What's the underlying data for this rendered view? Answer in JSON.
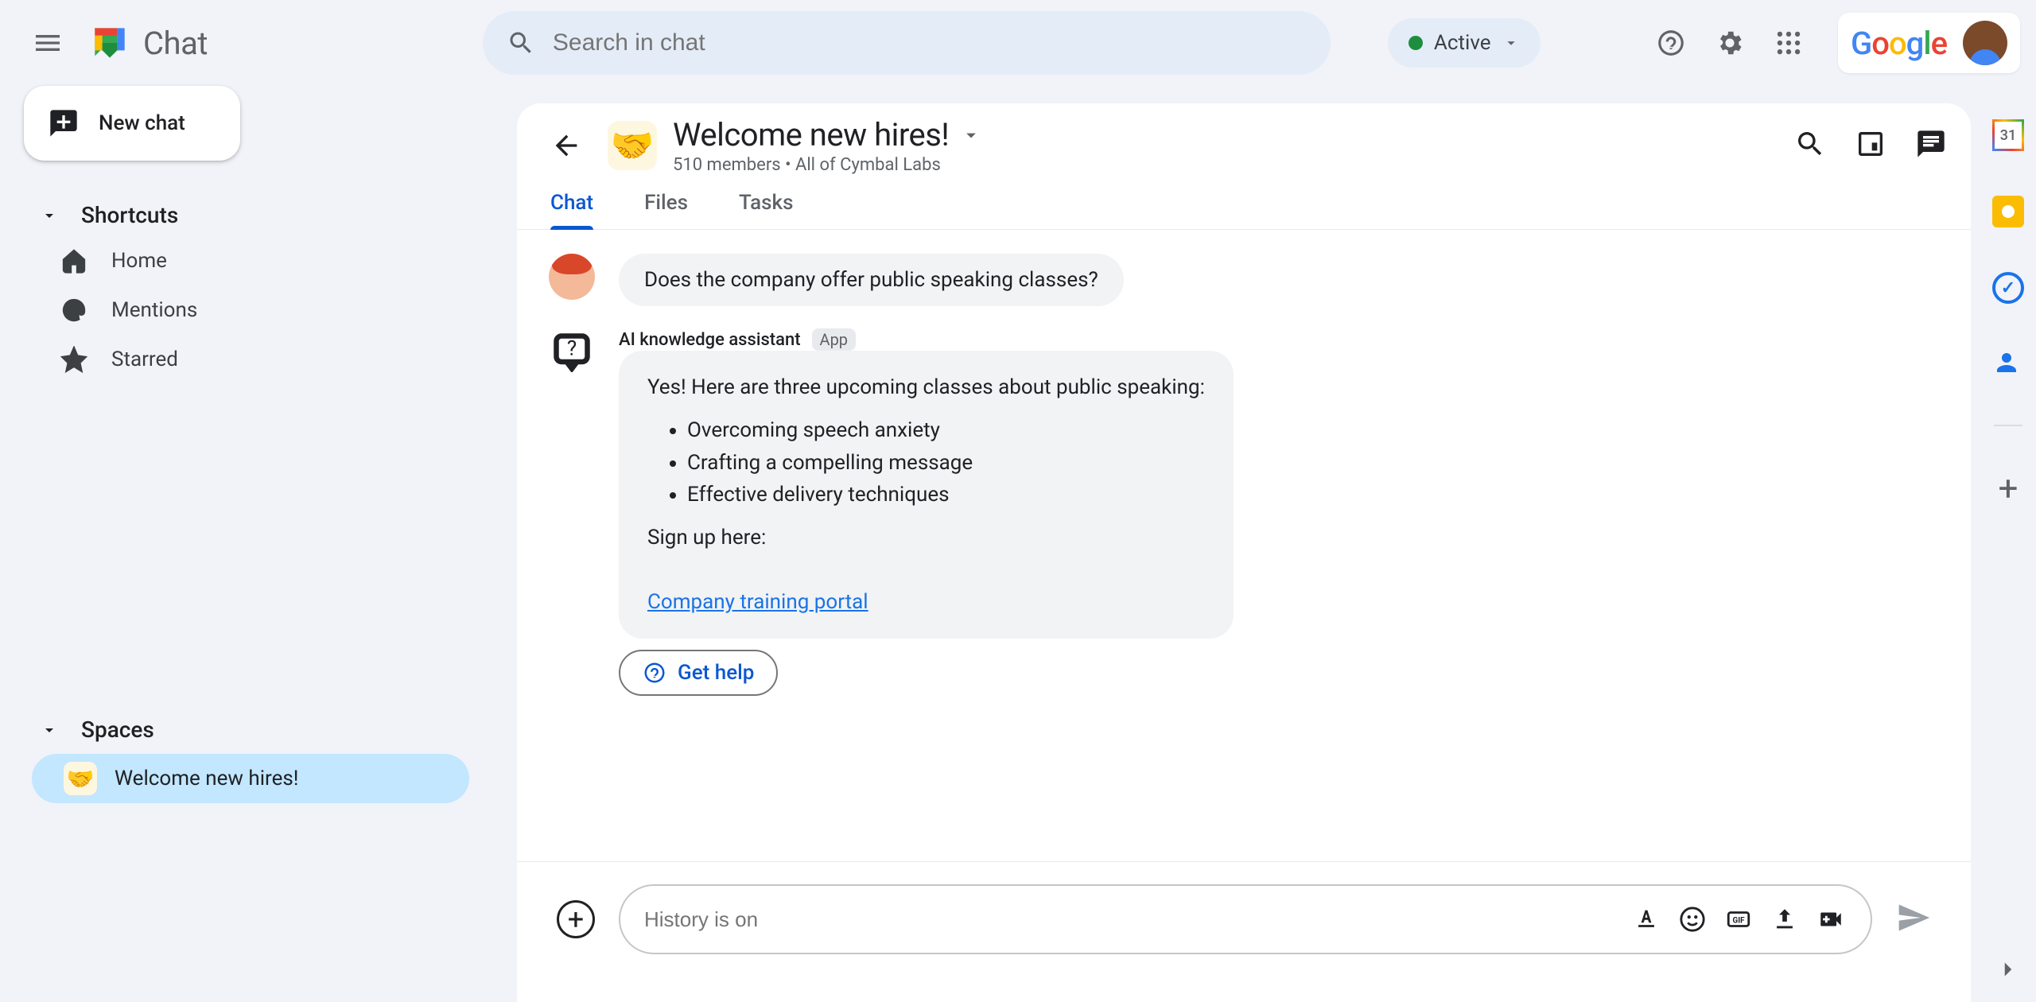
{
  "app": {
    "name": "Chat",
    "search_placeholder": "Search in chat",
    "status_label": "Active",
    "brand": "Google"
  },
  "sidebar": {
    "new_chat_label": "New chat",
    "shortcuts_label": "Shortcuts",
    "home_label": "Home",
    "mentions_label": "Mentions",
    "starred_label": "Starred",
    "spaces_label": "Spaces",
    "space_item_label": "Welcome new hires!"
  },
  "room": {
    "title": "Welcome new hires!",
    "subtitle": "510 members  •  All of Cymbal Labs",
    "tabs": {
      "chat": "Chat",
      "files": "Files",
      "tasks": "Tasks"
    }
  },
  "messages": {
    "user_question": "Does the company offer public speaking classes?",
    "ai_name": "AI knowledge assistant",
    "ai_badge": "App",
    "ai_intro": "Yes! Here are three upcoming classes about public speaking:",
    "ai_items": {
      "0": "Overcoming speech anxiety",
      "1": "Crafting a compelling message",
      "2": "Effective delivery techniques"
    },
    "ai_signup": "Sign up here:",
    "ai_link": "Company training portal",
    "get_help_label": "Get help"
  },
  "composer": {
    "placeholder": "History is on"
  },
  "rail": {
    "calendar_day": "31"
  }
}
